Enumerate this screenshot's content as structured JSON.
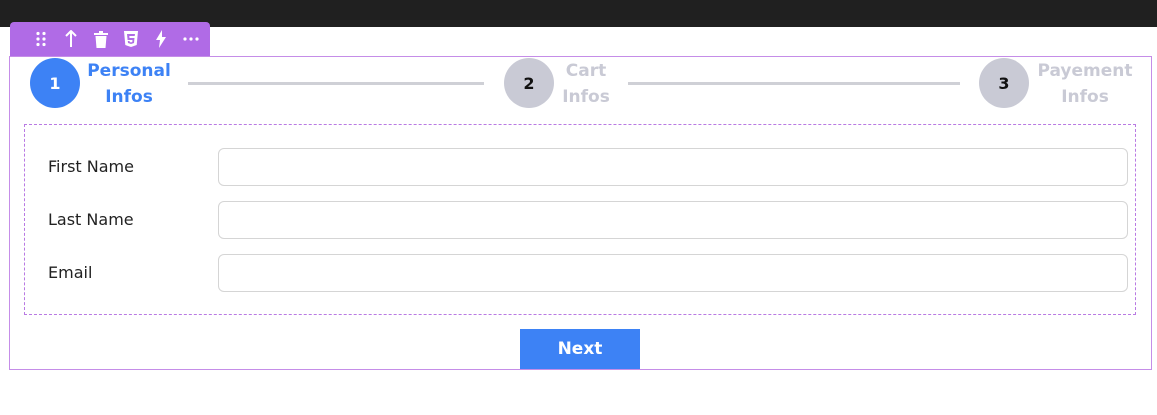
{
  "toolbar": {
    "icons": [
      "drag-handle-icon",
      "arrow-up-icon",
      "trash-icon",
      "css3-icon",
      "bolt-icon",
      "more-icon"
    ]
  },
  "stepper": {
    "steps": [
      {
        "number": "1",
        "label_line1": "Personal",
        "label_line2": "Infos",
        "state": "active"
      },
      {
        "number": "2",
        "label_line1": "Cart",
        "label_line2": "Infos",
        "state": "inactive"
      },
      {
        "number": "3",
        "label_line1": "Payement",
        "label_line2": "Infos",
        "state": "inactive"
      }
    ],
    "active_color": "#3d82f5",
    "inactive_color": "#c9cad5"
  },
  "form": {
    "fields": [
      {
        "label": "First Name",
        "value": ""
      },
      {
        "label": "Last Name",
        "value": ""
      },
      {
        "label": "Email",
        "value": ""
      }
    ]
  },
  "actions": {
    "next_label": "Next"
  },
  "colors": {
    "accent": "#3d82f5",
    "editor_purple": "#b06be6"
  }
}
